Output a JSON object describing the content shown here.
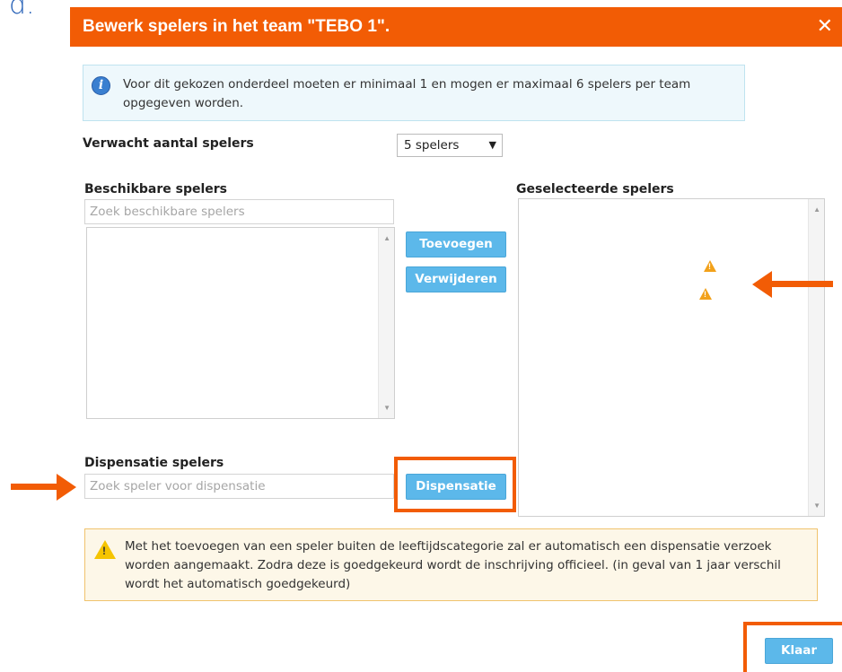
{
  "background": {
    "fragment": "d."
  },
  "dialog": {
    "title": "Bewerk spelers in het team \"TEBO 1\".",
    "close_glyph": "✕"
  },
  "info": {
    "icon": "info-icon",
    "text": "Voor dit gekozen onderdeel moeten er minimaal 1 en mogen er maximaal 6 spelers per team opgegeven worden."
  },
  "expected_players": {
    "label": "Verwacht aantal spelers",
    "selected": "5 spelers"
  },
  "available": {
    "label": "Beschikbare spelers",
    "search_placeholder": "Zoek beschikbare spelers"
  },
  "selected": {
    "label": "Geselecteerde spelers",
    "warning_icon_count": 2
  },
  "actions": {
    "add_label": "Toevoegen",
    "remove_label": "Verwijderen"
  },
  "dispensation": {
    "label": "Dispensatie spelers",
    "search_placeholder": "Zoek speler voor dispensatie",
    "button_label": "Dispensatie"
  },
  "warning": {
    "icon": "warning-icon",
    "text": "Met het toevoegen van een speler buiten de leeftijdscategorie zal er automatisch een dispensatie verzoek worden aangemaakt. Zodra deze is goedgekeurd wordt de inschrijving officieel. (in geval van 1 jaar verschil wordt het automatisch goedgekeurd)"
  },
  "footer": {
    "done_label": "Klaar"
  },
  "colors": {
    "accent": "#f25c05",
    "button": "#5cb8ea",
    "info_bg": "#eef8fc",
    "warning_bg": "#fdf7e8"
  }
}
